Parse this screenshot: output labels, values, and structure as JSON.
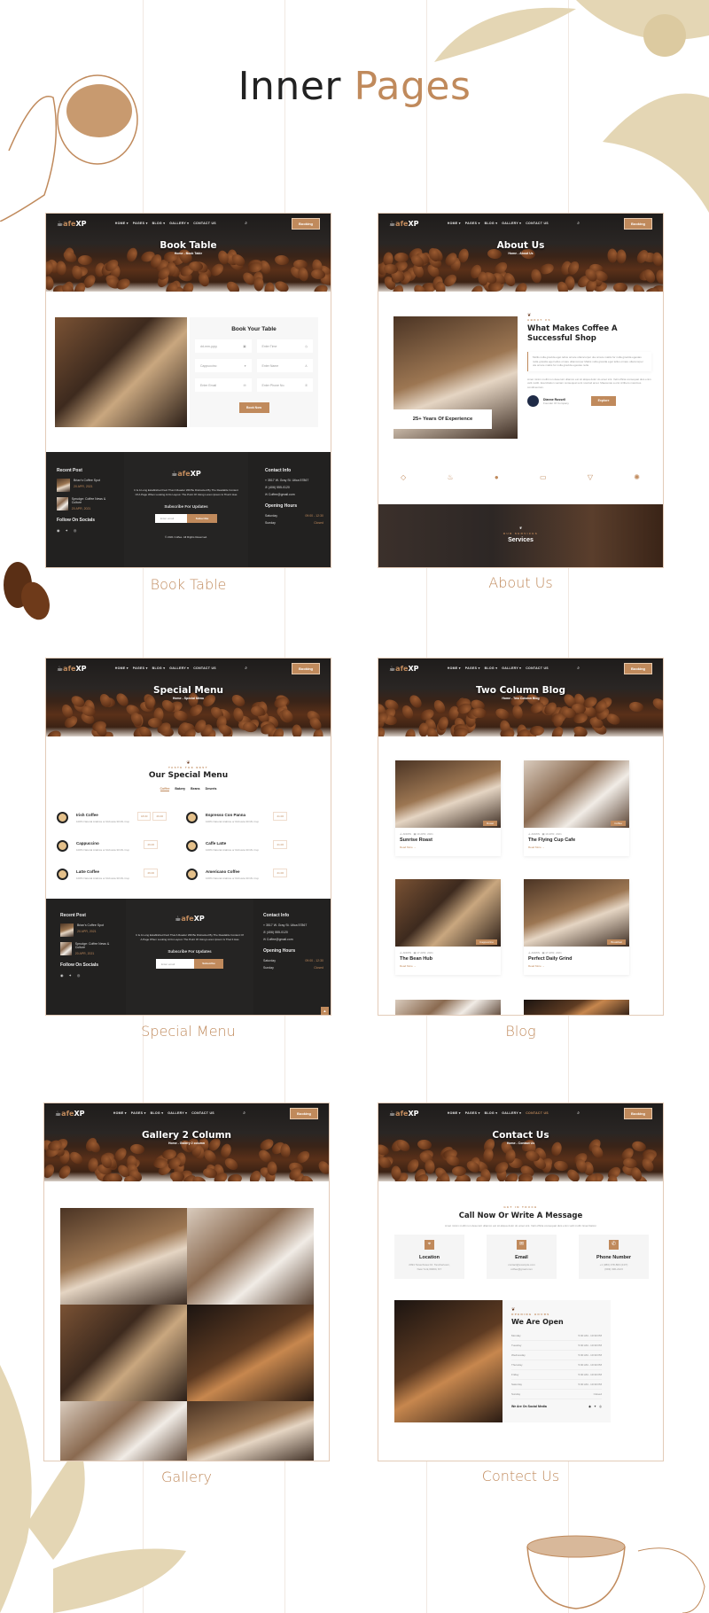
{
  "heading": {
    "part1": "Inner",
    "part2": "Pages"
  },
  "colors": {
    "accent": "#c08a5c",
    "dark": "#222120",
    "border": "#e3cbb8"
  },
  "nav": {
    "logo_prefix": "afe",
    "logo_suffix": "XP",
    "items": [
      "HOME ▾",
      "PAGES ▾",
      "BLOG ▾",
      "GALLERY ▾",
      "CONTACT US"
    ],
    "search_icon": "search-icon",
    "booking": "Booking"
  },
  "footer": {
    "recent_post": "Recent Post",
    "posts": [
      {
        "title": "Brian's Coffee Spot",
        "date": "20 APR, 2021"
      },
      {
        "title": "Sprudge: Coffee News & Culture",
        "date": "20 APR, 2021"
      }
    ],
    "follow": "Follow On Socials",
    "about": "It Is A Long Established Fact That A Reader Will Be Distracted By The Readable Content Of A Page When Looking At Its Layout. The Point Of Using Lorem Ipsum Is That It Has",
    "subscribe_title": "Subscribe For Updates",
    "email_placeholder": "Enter email",
    "subscribe_btn": "Subscribe",
    "contact_title": "Contact Info",
    "address": "3517 W. Gray St. Utica 57867",
    "phone": "(406) 555-0120",
    "email": "Coffee@gmail.com",
    "hours_title": "Opening Hours",
    "hours": [
      {
        "day": "Saturday",
        "time": "09:00 - 12:30"
      },
      {
        "day": "Sunday",
        "time": "Closed"
      }
    ],
    "copyright": "© 2021 Coffee. All Rights Reserved."
  },
  "pages": {
    "book": {
      "hero": "Book Table",
      "crumb": "Home - Book Table",
      "label": "Book Table",
      "form_title": "Book Your Table",
      "fields": [
        "dd-mm-yyyy",
        "Enter Time",
        "Cappuccino",
        "Enter Name",
        "Enter Email",
        "Enter Phone No."
      ],
      "submit": "Book Now"
    },
    "about": {
      "hero": "About Us",
      "crumb": "Home - About Us",
      "label": "About Us",
      "experience": "25+ Years Of Experience",
      "tag": "ABOUT US",
      "title": "What Makes Coffee A Successful Shop",
      "quote": "Mollis nulla gravida eget tellus ornare ullamcorper ula ornare mattis for nulla gravida egestas nulla gravida eget tellus ornare ullamcorper Mattis nulla gravida eget tellus ornare ullamcorper ula ornare mattis for nulla gravida egestas nulla",
      "body": "Amet minim mollit non deserunt ullamco est sit aliqua dolor do amet sint. Velit officia consequat duis enim velit mollit. Exercitation veniam consequat sunt nostrud amet. Maecenas a orsi id libero maximus condimentum.",
      "author": "Dianne Russell",
      "author_role": "Founder Of Company",
      "explore": "Explore",
      "brands": [
        "brand-logo-1",
        "brand-logo-2",
        "brand-logo-3",
        "brand-logo-4",
        "brand-logo-5",
        "brand-logo-6"
      ],
      "services_tag": "OUR SERVICES",
      "services": "Services"
    },
    "menu": {
      "hero": "Special Menu",
      "crumb": "Home - Special Menu",
      "label": "Special Menu",
      "tag": "TASTE THE BEST",
      "title": "Our Special Menu",
      "tabs": [
        "Coffee",
        "Bakery",
        "Beans",
        "Deserts"
      ],
      "items": [
        {
          "name": "Irish Coffee",
          "desc": "100% Natural Arabica or Robusta 30 ML Cup",
          "prices": [
            "18.00",
            "26.00"
          ]
        },
        {
          "name": "Espresso Con Panna",
          "desc": "100% Natural Arabica or Robusta 30 ML Cup",
          "prices": [
            "21.00"
          ]
        },
        {
          "name": "Cappuccino",
          "desc": "100% Natural Arabica or Robusta 30 ML Cup",
          "prices": [
            "26.00"
          ]
        },
        {
          "name": "Caffe Latte",
          "desc": "100% Natural Arabica or Robusta 30 ML Cup",
          "prices": [
            "21.00"
          ]
        },
        {
          "name": "Latte Coffee",
          "desc": "100% Natural Arabica or Robusta 30 ML Cup",
          "prices": [
            "26.00"
          ]
        },
        {
          "name": "Americano Coffee",
          "desc": "100% Natural Arabica or Robusta 30 ML Cup",
          "prices": [
            "21.00"
          ]
        }
      ]
    },
    "blog": {
      "hero": "Two Column Blog",
      "crumb": "Home - Two Column Blog",
      "label": "Blog",
      "posts": [
        {
          "title": "Sunrise Roast",
          "author": "ADMIN",
          "date": "19 APR, 2021",
          "cat": "Roast",
          "more": "Read More →"
        },
        {
          "title": "The Flying Cup Cafe",
          "author": "ADMIN",
          "date": "19 APR, 2021",
          "cat": "Coffee",
          "more": "Read More →"
        },
        {
          "title": "The Bean Hub",
          "author": "ADMIN",
          "date": "17 APR, 2021",
          "cat": "Cappuccino",
          "more": "Read More →"
        },
        {
          "title": "Perfect Daily Grind",
          "author": "ADMIN",
          "date": "17 APR, 2021",
          "cat": "Breakfast",
          "more": "Read More →"
        }
      ]
    },
    "gallery": {
      "hero": "Gallery 2 Column",
      "crumb": "Home - Gallery 2 column",
      "label": "Gallery"
    },
    "contact": {
      "hero": "Contact Us",
      "crumb": "Home - Contact Us",
      "label": "Contect Us",
      "tag": "GET IN TOUCH",
      "title": "Call Now Or Write A Message",
      "subtitle": "Amet minim mollit non deserunt ullamco est sit aliqua dolor do amet sint. Velit officia consequat duis enim velit mollit. Exercitation",
      "cards": [
        {
          "title": "Location",
          "line1": "2091 Tanechview Dr. Tanchertown,",
          "line2": "New York,30404, NY"
        },
        {
          "title": "Email",
          "line1": "contact@example.com",
          "line2": "coffee@gmail.com"
        },
        {
          "title": "Phone Number",
          "line1": "+1 (380) 478-803 (24/7)",
          "line2": "(603) 330-2123"
        }
      ],
      "hours_tag": "OPENING HOURS",
      "hours_title": "We Are Open",
      "hours": [
        {
          "day": "Monday",
          "time": "5:00 AM - 10:30 PM"
        },
        {
          "day": "Tuesday",
          "time": "5:00 AM - 10:30 PM"
        },
        {
          "day": "Wednesday",
          "time": "5:00 AM - 10:30 PM"
        },
        {
          "day": "Thursday",
          "time": "5:00 AM - 10:30 PM"
        },
        {
          "day": "Friday",
          "time": "5:00 AM - 10:30 PM"
        },
        {
          "day": "Saturday",
          "time": "5:00 AM - 10:30 PM"
        },
        {
          "day": "Sunday",
          "time": "Closed"
        }
      ],
      "social": "We Are On Social Media"
    }
  }
}
